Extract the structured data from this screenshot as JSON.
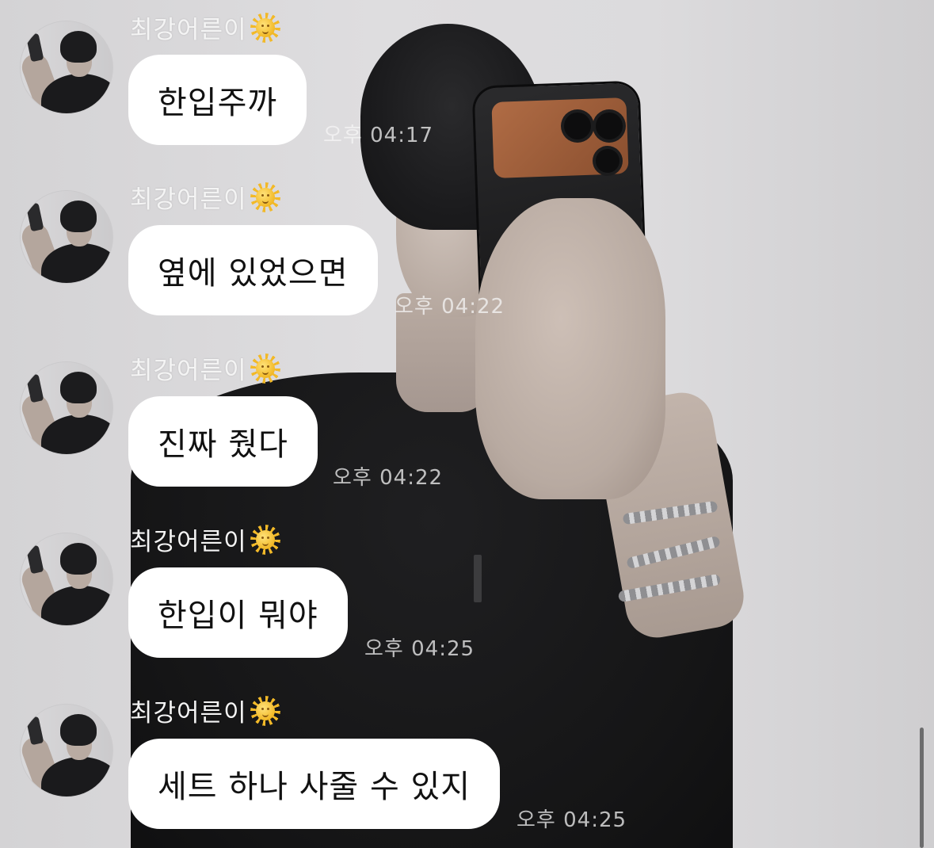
{
  "sender_name": "최강어른이",
  "sender_emoji": "sun-with-face-emoji",
  "messages": [
    {
      "text": "한입주까",
      "time": "오후 04:17"
    },
    {
      "text": "옆에 있었으면",
      "time": "오후 04:22"
    },
    {
      "text": "진짜 줬다",
      "time": "오후 04:22"
    },
    {
      "text": "한입이 뭐야",
      "time": "오후 04:25"
    },
    {
      "text": "세트 하나 사줄 수 있지",
      "time": "오후 04:25"
    }
  ],
  "colors": {
    "bubble": "#ffffff",
    "name_text": "#f4f4f4",
    "time_text": "#f5f5f6"
  }
}
